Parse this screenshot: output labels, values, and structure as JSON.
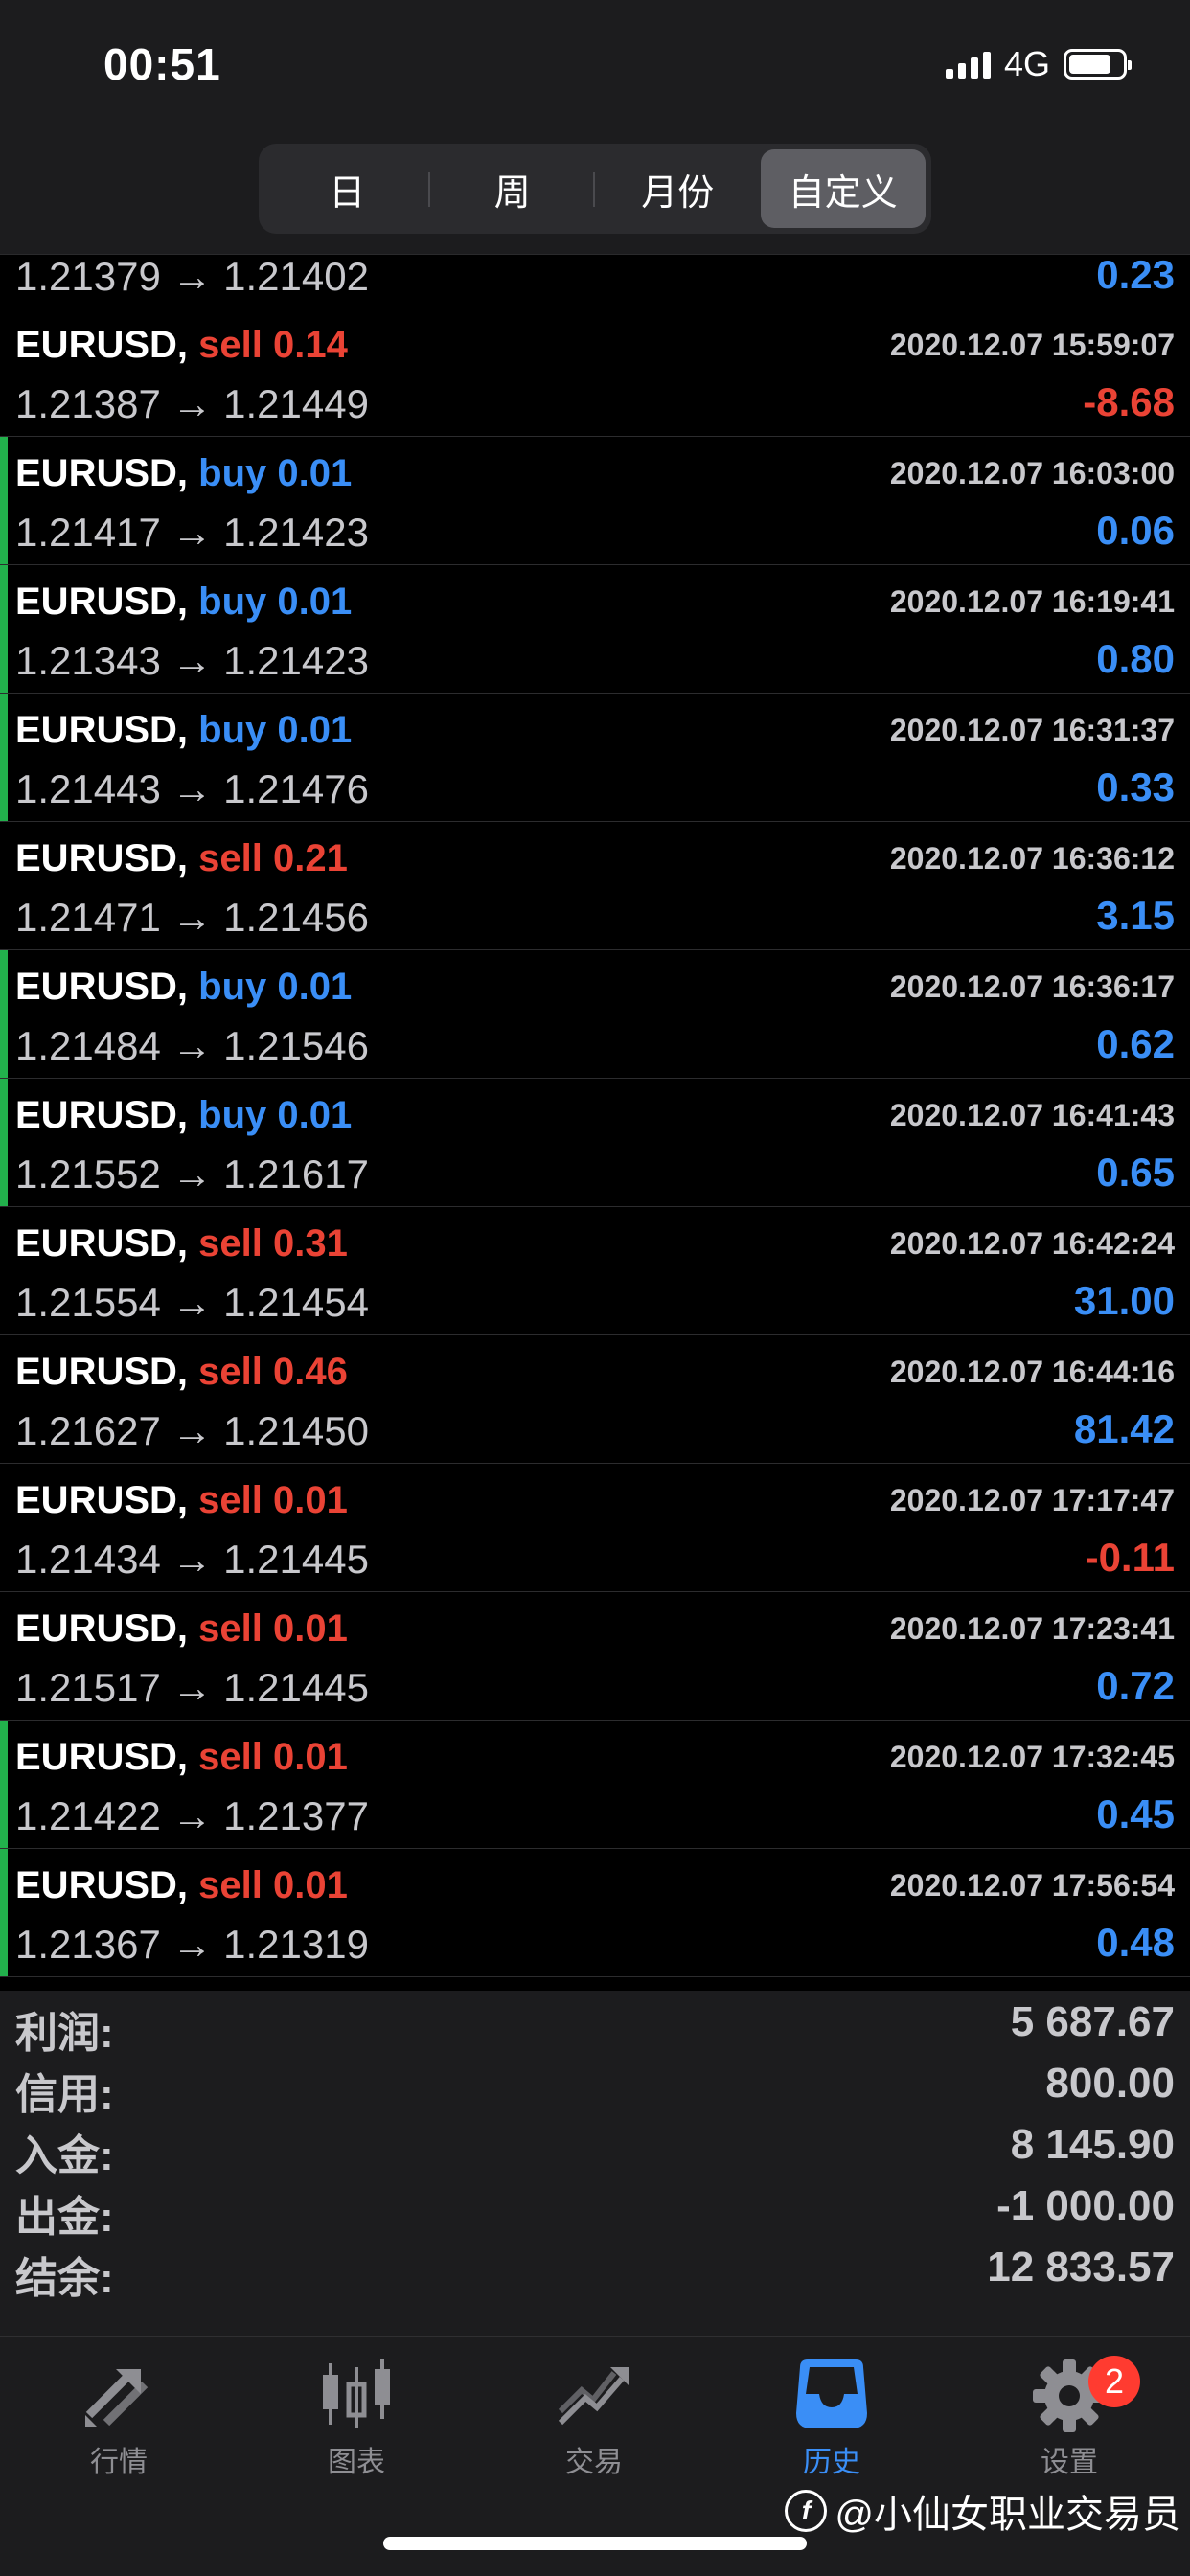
{
  "status_bar": {
    "time": "00:51",
    "network": "4G"
  },
  "period_tabs": [
    {
      "label": "日",
      "active": false
    },
    {
      "label": "周",
      "active": false
    },
    {
      "label": "月份",
      "active": false
    },
    {
      "label": "自定义",
      "active": true
    }
  ],
  "partial_row": {
    "prices": "1.21379 → 1.21402",
    "profit": "0.23"
  },
  "trades": [
    {
      "symbol": "EURUSD,",
      "direction": "sell",
      "volume": "0.14",
      "time": "2020.12.07 15:59:07",
      "prices": "1.21387 → 1.21449",
      "profit": "-8.68",
      "bar": false
    },
    {
      "symbol": "EURUSD,",
      "direction": "buy",
      "volume": "0.01",
      "time": "2020.12.07 16:03:00",
      "prices": "1.21417 → 1.21423",
      "profit": "0.06",
      "bar": true
    },
    {
      "symbol": "EURUSD,",
      "direction": "buy",
      "volume": "0.01",
      "time": "2020.12.07 16:19:41",
      "prices": "1.21343 → 1.21423",
      "profit": "0.80",
      "bar": true
    },
    {
      "symbol": "EURUSD,",
      "direction": "buy",
      "volume": "0.01",
      "time": "2020.12.07 16:31:37",
      "prices": "1.21443 → 1.21476",
      "profit": "0.33",
      "bar": true
    },
    {
      "symbol": "EURUSD,",
      "direction": "sell",
      "volume": "0.21",
      "time": "2020.12.07 16:36:12",
      "prices": "1.21471 → 1.21456",
      "profit": "3.15",
      "bar": false
    },
    {
      "symbol": "EURUSD,",
      "direction": "buy",
      "volume": "0.01",
      "time": "2020.12.07 16:36:17",
      "prices": "1.21484 → 1.21546",
      "profit": "0.62",
      "bar": true
    },
    {
      "symbol": "EURUSD,",
      "direction": "buy",
      "volume": "0.01",
      "time": "2020.12.07 16:41:43",
      "prices": "1.21552 → 1.21617",
      "profit": "0.65",
      "bar": true
    },
    {
      "symbol": "EURUSD,",
      "direction": "sell",
      "volume": "0.31",
      "time": "2020.12.07 16:42:24",
      "prices": "1.21554 → 1.21454",
      "profit": "31.00",
      "bar": false
    },
    {
      "symbol": "EURUSD,",
      "direction": "sell",
      "volume": "0.46",
      "time": "2020.12.07 16:44:16",
      "prices": "1.21627 → 1.21450",
      "profit": "81.42",
      "bar": false
    },
    {
      "symbol": "EURUSD,",
      "direction": "sell",
      "volume": "0.01",
      "time": "2020.12.07 17:17:47",
      "prices": "1.21434 → 1.21445",
      "profit": "-0.11",
      "bar": false
    },
    {
      "symbol": "EURUSD,",
      "direction": "sell",
      "volume": "0.01",
      "time": "2020.12.07 17:23:41",
      "prices": "1.21517 → 1.21445",
      "profit": "0.72",
      "bar": false
    },
    {
      "symbol": "EURUSD,",
      "direction": "sell",
      "volume": "0.01",
      "time": "2020.12.07 17:32:45",
      "prices": "1.21422 → 1.21377",
      "profit": "0.45",
      "bar": true
    },
    {
      "symbol": "EURUSD,",
      "direction": "sell",
      "volume": "0.01",
      "time": "2020.12.07 17:56:54",
      "prices": "1.21367 → 1.21319",
      "profit": "0.48",
      "bar": true
    }
  ],
  "summary": [
    {
      "label": "利润:",
      "value": "5 687.67"
    },
    {
      "label": "信用:",
      "value": "800.00"
    },
    {
      "label": "入金:",
      "value": "8 145.90"
    },
    {
      "label": "出金:",
      "value": "-1 000.00"
    },
    {
      "label": "结余:",
      "value": "12 833.57"
    }
  ],
  "tabs": [
    {
      "label": "行情",
      "icon": "quotes-arrows-icon",
      "active": false
    },
    {
      "label": "图表",
      "icon": "candlestick-chart-icon",
      "active": false
    },
    {
      "label": "交易",
      "icon": "trade-trend-icon",
      "active": false
    },
    {
      "label": "历史",
      "icon": "history-inbox-icon",
      "active": true
    },
    {
      "label": "设置",
      "icon": "gear-icon",
      "active": false,
      "badge": "2"
    }
  ],
  "watermark": "@小仙女职业交易员",
  "colors": {
    "buy": "#3a8ef6",
    "sell": "#ea4335",
    "open_bar": "#22b14c",
    "active_tab": "#3a8ef6"
  }
}
